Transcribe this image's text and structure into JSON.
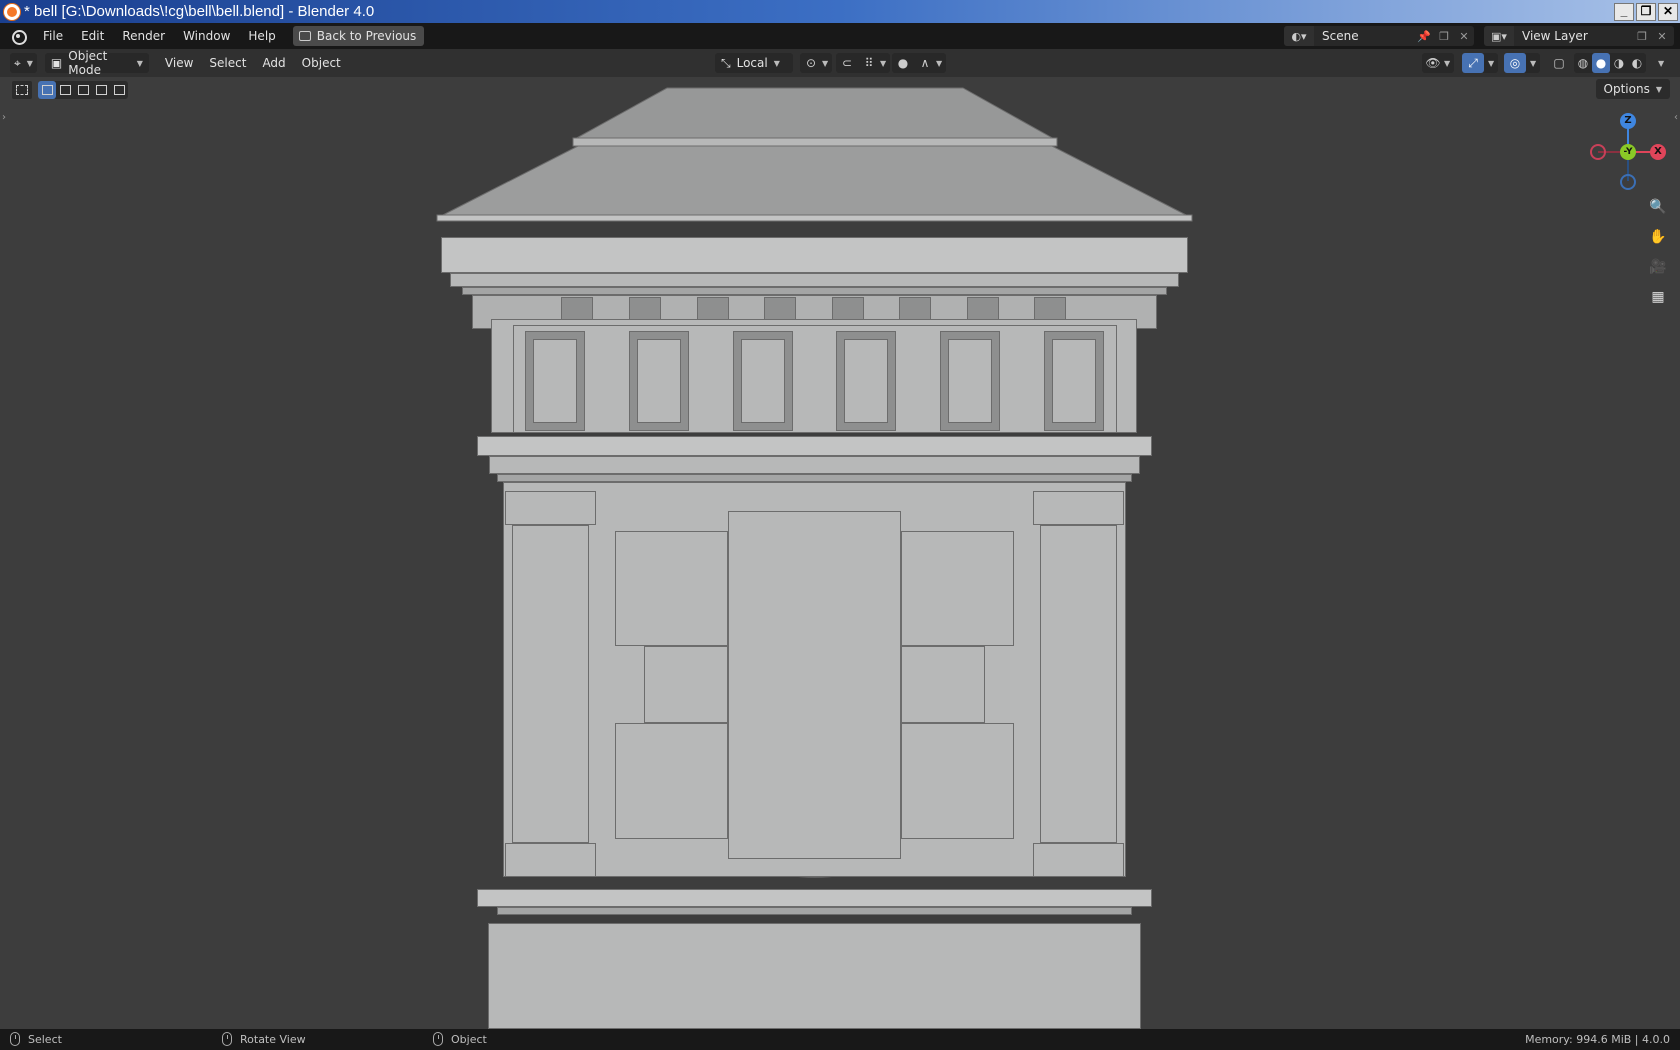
{
  "window": {
    "title": "* bell [G:\\Downloads\\!cg\\bell\\bell.blend] - Blender 4.0",
    "controls": [
      "minimize",
      "restore",
      "close"
    ]
  },
  "menubar": {
    "items": [
      "File",
      "Edit",
      "Render",
      "Window",
      "Help"
    ],
    "back_button": "Back to Previous",
    "scene": "Scene",
    "view_layer": "View Layer"
  },
  "viewport_header": {
    "mode": "Object Mode",
    "menus": [
      "View",
      "Select",
      "Add",
      "Object"
    ],
    "transform_orientation": "Local"
  },
  "viewport": {
    "options_label": "Options",
    "gizmo": {
      "z": "Z",
      "y": "-Y",
      "x": "X"
    }
  },
  "statusbar": {
    "hints": [
      "Select",
      "Rotate View",
      "Object"
    ],
    "memory": "Memory: 994.6 MiB | 4.0.0"
  },
  "colors": {
    "viewport_bg": "#3d3d3d",
    "header_bg": "#303030",
    "bar_bg": "#181818",
    "accent": "#4772b3",
    "axis_x": "#e0455a",
    "axis_y": "#8ac926",
    "axis_z": "#3f86e0"
  }
}
